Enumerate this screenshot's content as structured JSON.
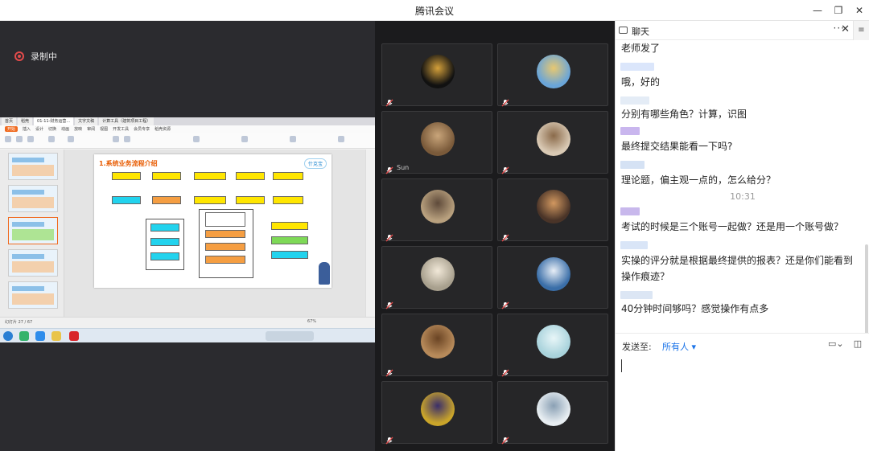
{
  "window": {
    "title": "腾讯会议"
  },
  "recording": {
    "label": "录制中",
    "color": "#e34b4b"
  },
  "shared_screen": {
    "wps_tabs": [
      "首页",
      "稻壳",
      "01-11-财务运营...",
      "文字文稿",
      "计算工具（建筑项目工程）"
    ],
    "wps_menu": [
      "开始",
      "插入",
      "设计",
      "切换",
      "动画",
      "放映",
      "审阅",
      "视图",
      "开发工具",
      "会员专享",
      "稻壳资源"
    ],
    "slide_title": "1.系统业务流程介绍",
    "slide_logo": "什克宝",
    "status_text": "幻灯片 27 / 67",
    "zoom": "67%"
  },
  "participants": [
    {
      "name": "",
      "avatar_color": "#111111",
      "accent": "#d4a03a"
    },
    {
      "name": "",
      "avatar_color": "#6aa5d8",
      "accent": "#e8c870"
    },
    {
      "name": "Sun",
      "avatar_color": "#7a5a3a",
      "accent": "#c9a57a"
    },
    {
      "name": "",
      "avatar_color": "#d9c9b4",
      "accent": "#8a6a4a"
    },
    {
      "name": "",
      "avatar_color": "#b8a07e",
      "accent": "#5e4a3a"
    },
    {
      "name": "",
      "avatar_color": "#4a3428",
      "accent": "#d29860"
    },
    {
      "name": "",
      "avatar_color": "#a8a08e",
      "accent": "#f1e8d8"
    },
    {
      "name": "",
      "avatar_color": "#3a6ea8",
      "accent": "#e8eef6"
    },
    {
      "name": "",
      "avatar_color": "#b78a5a",
      "accent": "#6a4424"
    },
    {
      "name": "",
      "avatar_color": "#a9d3dc",
      "accent": "#e8f6f8"
    },
    {
      "name": "",
      "avatar_color": "#caa52a",
      "accent": "#3a2e6a"
    },
    {
      "name": "",
      "avatar_color": "#e8eef2",
      "accent": "#8aa0b4"
    }
  ],
  "chat": {
    "title": "聊天",
    "more": "···",
    "side_menu": "≡",
    "messages": [
      {
        "text": "老师发了"
      },
      {
        "text": "哦，好的"
      },
      {
        "text": "分别有哪些角色？计算，识图"
      },
      {
        "text": "最终提交结果能看一下吗?"
      },
      {
        "text": "理论题，偏主观一点的，怎么给分？"
      },
      {
        "text": "考试的时候是三个账号一起做？还是用一个账号做？"
      },
      {
        "text": "实操的评分就是根据最终提供的报表？还是你们能看到操作痕迹？"
      },
      {
        "text": "40分钟时间够吗？感觉操作有点多"
      }
    ],
    "timestamp": "10:31",
    "send_to_label": "发送至:",
    "recipient": "所有人 ▾",
    "accent": "#1a73e8"
  }
}
